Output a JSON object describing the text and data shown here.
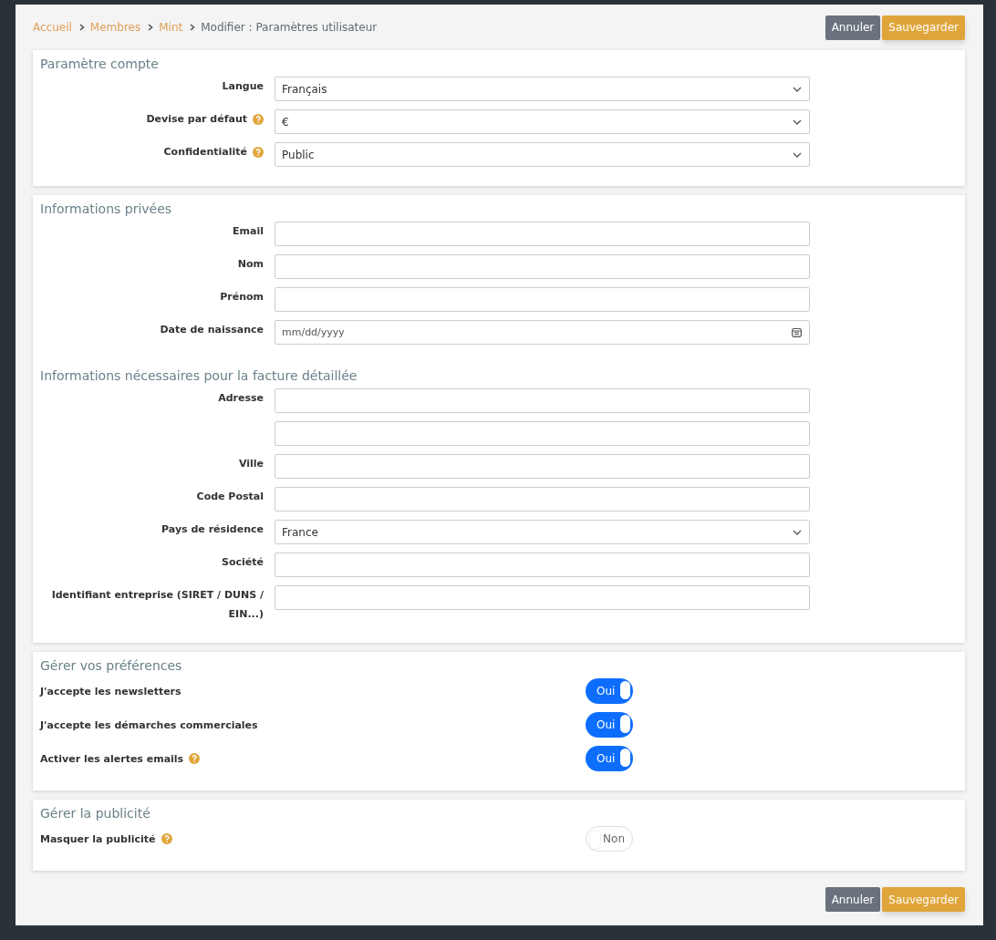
{
  "breadcrumb": [
    {
      "label": "Accueil",
      "kind": "link"
    },
    {
      "label": "Membres",
      "kind": "link"
    },
    {
      "label": "Mint",
      "kind": "link"
    },
    {
      "label": "Modifier : Paramètres utilisateur",
      "kind": "current"
    }
  ],
  "actions_top": [
    {
      "label": "Annuler",
      "kind": "secondary"
    },
    {
      "label": "Sauvegarder",
      "kind": "primary"
    }
  ],
  "sections": [
    {
      "title": "Paramètre compte",
      "items": [
        {
          "kind": "select",
          "label": "Langue",
          "help": false,
          "value": "Français"
        },
        {
          "kind": "select",
          "label": "Devise par défaut",
          "help": true,
          "value": "€"
        },
        {
          "kind": "select",
          "label": "Confidentialité",
          "help": true,
          "value": "Public"
        }
      ]
    },
    {
      "title": "Informations privées",
      "items": [
        {
          "kind": "text",
          "label": "Email",
          "help": false
        },
        {
          "kind": "text",
          "label": "Nom",
          "help": false
        },
        {
          "kind": "text",
          "label": "Prénom",
          "help": false
        },
        {
          "kind": "date",
          "label": "Date de naissance",
          "help": false,
          "placeholder": "mm/dd/yyyy"
        },
        {
          "kind": "heading",
          "label": "Informations nécessaires pour la facture détaillée"
        },
        {
          "kind": "text",
          "label": "Adresse",
          "help": false
        },
        {
          "kind": "text",
          "help": false
        },
        {
          "kind": "text",
          "label": "Ville",
          "help": false
        },
        {
          "kind": "text",
          "label": "Code Postal",
          "help": false
        },
        {
          "kind": "select",
          "label": "Pays de résidence",
          "help": false,
          "value": "France"
        },
        {
          "kind": "text",
          "label": "Société",
          "help": false
        },
        {
          "kind": "text",
          "label": "Identifiant entreprise (SIRET / DUNS / EIN...)",
          "help": false
        }
      ]
    },
    {
      "title": "Gérer vos préférences",
      "items": [
        {
          "kind": "toggle",
          "label": "J'accepte les newsletters",
          "help": false,
          "on": true,
          "text": "Oui"
        },
        {
          "kind": "toggle",
          "label": "J'accepte les démarches commerciales",
          "help": false,
          "on": true,
          "text": "Oui"
        },
        {
          "kind": "toggle",
          "label": "Activer les alertes emails",
          "help": true,
          "on": true,
          "text": "Oui"
        }
      ]
    },
    {
      "title": "Gérer la publicité",
      "items": [
        {
          "kind": "toggle",
          "label": "Masquer la publicité",
          "help": true,
          "on": false,
          "text": "Non"
        }
      ]
    }
  ],
  "actions_bottom": [
    {
      "label": "Annuler",
      "kind": "secondary"
    },
    {
      "label": "Sauvegarder",
      "kind": "primary"
    }
  ]
}
